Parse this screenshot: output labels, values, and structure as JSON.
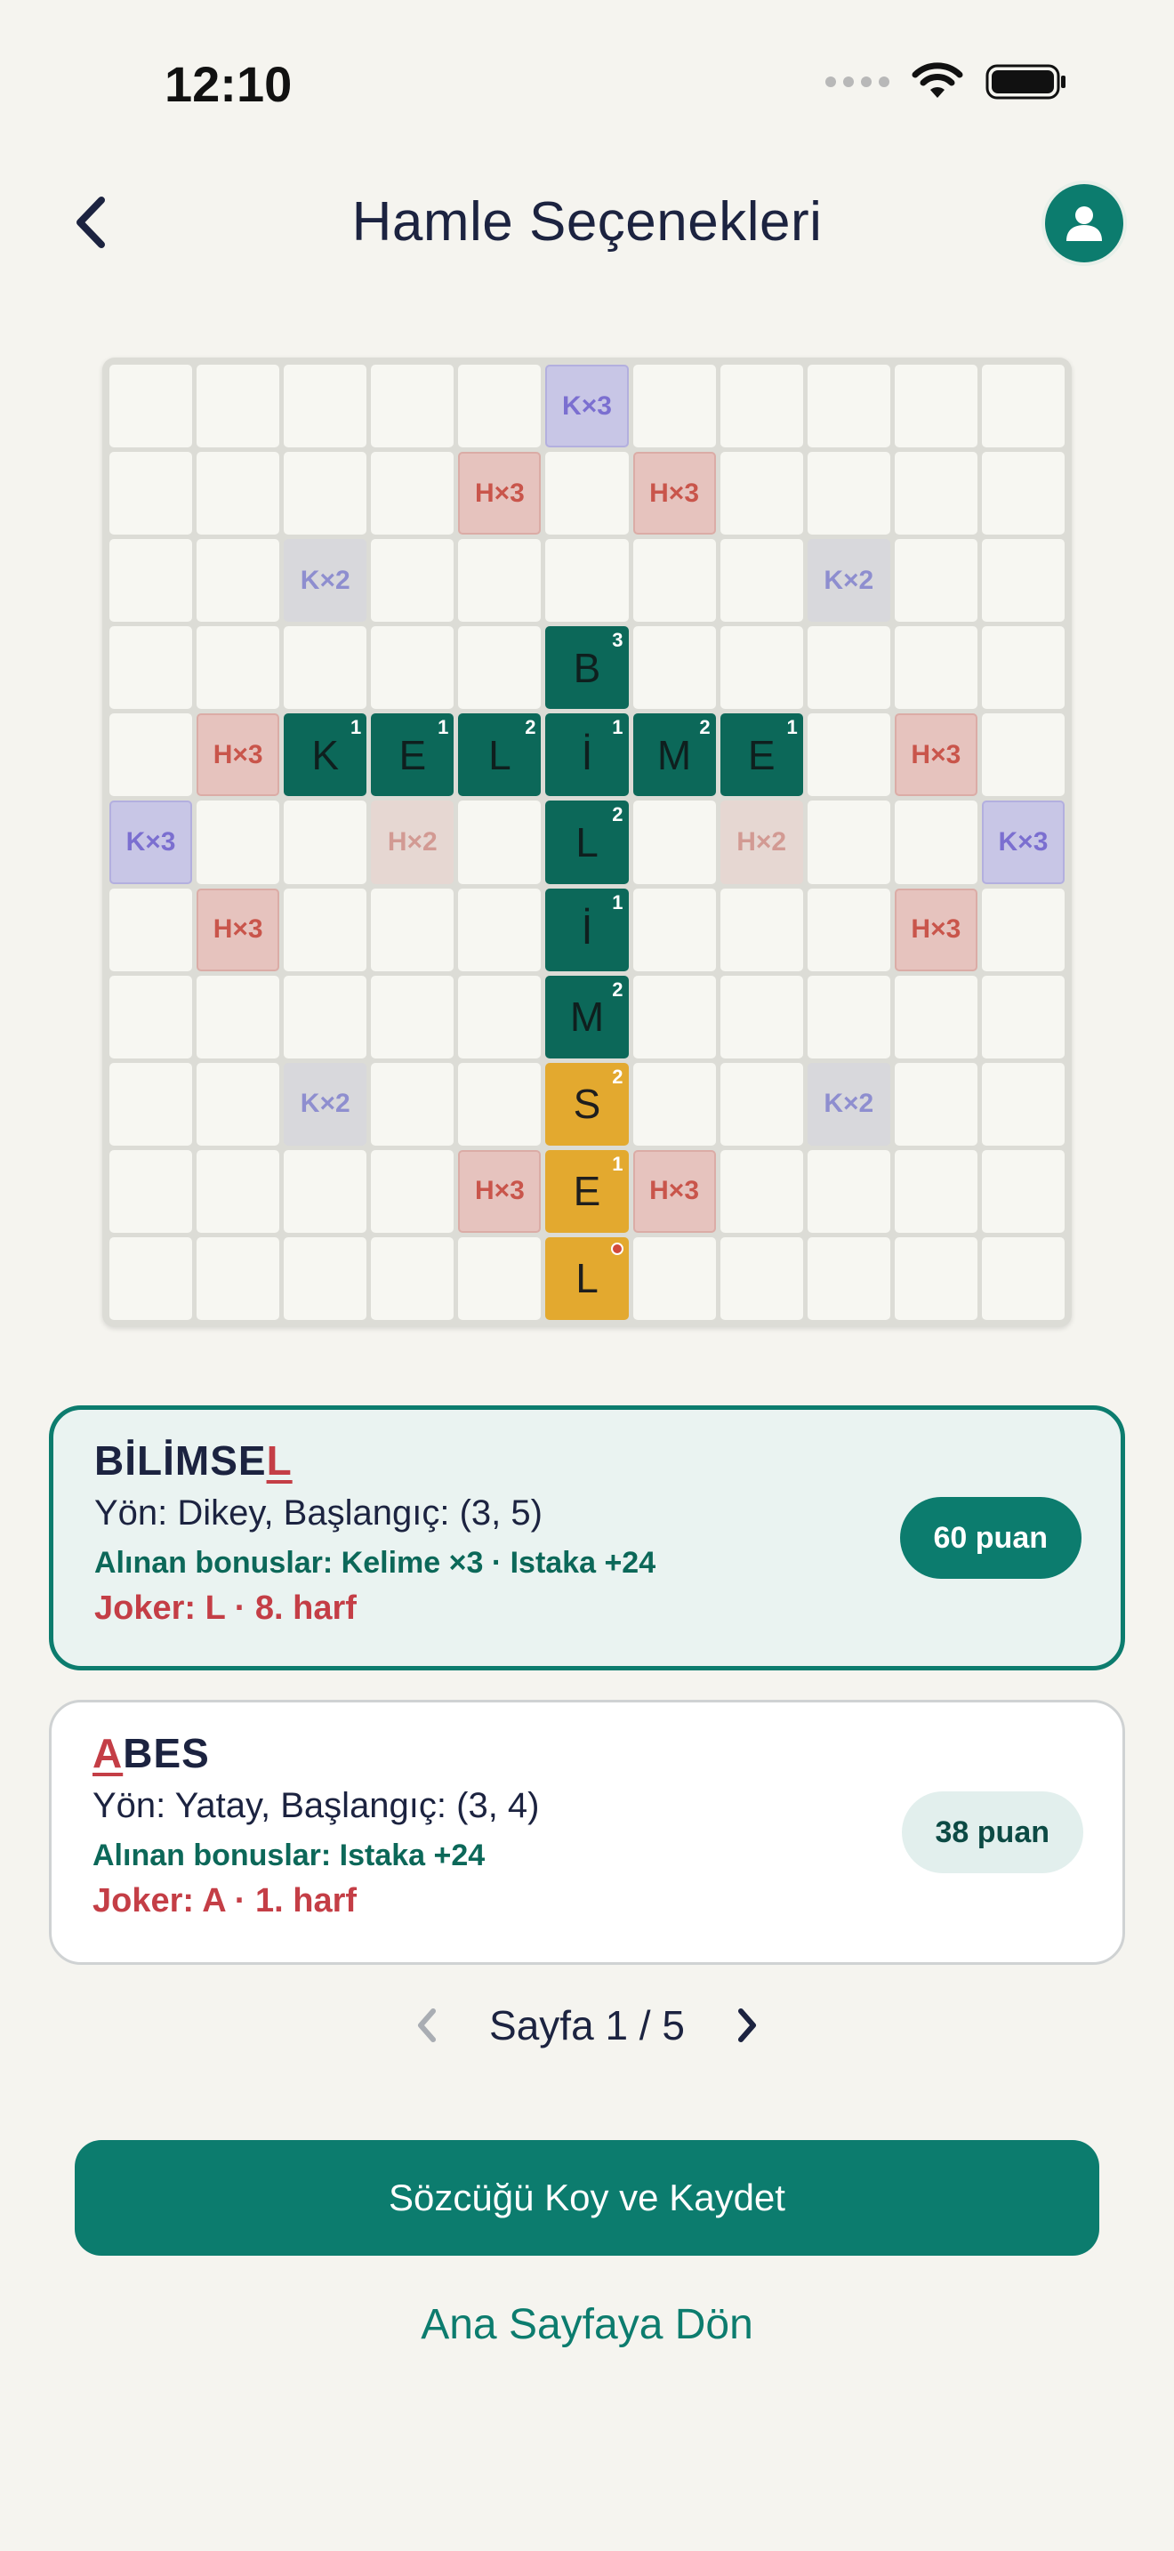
{
  "status_bar": {
    "time": "12:10"
  },
  "header": {
    "title": "Hamle Seçenekleri"
  },
  "board": {
    "size": 11,
    "bonuses": [
      {
        "row": 0,
        "col": 5,
        "type": "kx3",
        "label": "K×3"
      },
      {
        "row": 1,
        "col": 4,
        "type": "hx3",
        "label": "H×3"
      },
      {
        "row": 1,
        "col": 6,
        "type": "hx3",
        "label": "H×3"
      },
      {
        "row": 2,
        "col": 2,
        "type": "kx2",
        "label": "K×2"
      },
      {
        "row": 2,
        "col": 8,
        "type": "kx2",
        "label": "K×2"
      },
      {
        "row": 4,
        "col": 1,
        "type": "hx3",
        "label": "H×3"
      },
      {
        "row": 4,
        "col": 9,
        "type": "hx3",
        "label": "H×3"
      },
      {
        "row": 5,
        "col": 0,
        "type": "kx3",
        "label": "K×3"
      },
      {
        "row": 5,
        "col": 3,
        "type": "hx2",
        "label": "H×2"
      },
      {
        "row": 5,
        "col": 7,
        "type": "hx2",
        "label": "H×2"
      },
      {
        "row": 5,
        "col": 10,
        "type": "kx3",
        "label": "K×3"
      },
      {
        "row": 6,
        "col": 1,
        "type": "hx3",
        "label": "H×3"
      },
      {
        "row": 6,
        "col": 9,
        "type": "hx3",
        "label": "H×3"
      },
      {
        "row": 8,
        "col": 2,
        "type": "kx2",
        "label": "K×2"
      },
      {
        "row": 8,
        "col": 8,
        "type": "kx2",
        "label": "K×2"
      },
      {
        "row": 9,
        "col": 4,
        "type": "hx3",
        "label": "H×3"
      },
      {
        "row": 9,
        "col": 6,
        "type": "hx3",
        "label": "H×3"
      }
    ],
    "tiles": [
      {
        "row": 3,
        "col": 5,
        "letter": "B",
        "points": "3",
        "new": false
      },
      {
        "row": 4,
        "col": 2,
        "letter": "K",
        "points": "1",
        "new": false
      },
      {
        "row": 4,
        "col": 3,
        "letter": "E",
        "points": "1",
        "new": false
      },
      {
        "row": 4,
        "col": 4,
        "letter": "L",
        "points": "2",
        "new": false
      },
      {
        "row": 4,
        "col": 5,
        "letter": "İ",
        "points": "1",
        "new": false
      },
      {
        "row": 4,
        "col": 6,
        "letter": "M",
        "points": "2",
        "new": false
      },
      {
        "row": 4,
        "col": 7,
        "letter": "E",
        "points": "1",
        "new": false
      },
      {
        "row": 5,
        "col": 5,
        "letter": "L",
        "points": "2",
        "new": false
      },
      {
        "row": 6,
        "col": 5,
        "letter": "İ",
        "points": "1",
        "new": false
      },
      {
        "row": 7,
        "col": 5,
        "letter": "M",
        "points": "2",
        "new": false
      },
      {
        "row": 8,
        "col": 5,
        "letter": "S",
        "points": "2",
        "new": true
      },
      {
        "row": 9,
        "col": 5,
        "letter": "E",
        "points": "1",
        "new": true
      },
      {
        "row": 10,
        "col": 5,
        "letter": "L",
        "points": "",
        "new": true,
        "joker": true
      }
    ]
  },
  "moves": [
    {
      "word_plain": "BİLİMSE",
      "word_joker": "L",
      "direction": "Yön: Dikey, Başlangıç: (3, 5)",
      "bonuses": "Alınan bonuslar: Kelime ×3 · Istaka +24",
      "joker": "Joker: L · 8. harf",
      "score": "60 puan",
      "selected": true
    },
    {
      "word_joker": "A",
      "word_plain": "BES",
      "direction": "Yön: Yatay, Başlangıç: (3, 4)",
      "bonuses": "Alınan bonuslar: Istaka +24",
      "joker": "Joker: A · 1. harf",
      "score": "38 puan",
      "selected": false
    }
  ],
  "pagination": {
    "label": "Sayfa 1 / 5"
  },
  "actions": {
    "primary": "Sözcüğü Koy ve Kaydet",
    "secondary": "Ana Sayfaya Dön"
  },
  "colors": {
    "primary": "#0c7c6e",
    "placed_tile": "#0c6859",
    "new_tile": "#e3a92f",
    "joker": "#c43e46"
  }
}
